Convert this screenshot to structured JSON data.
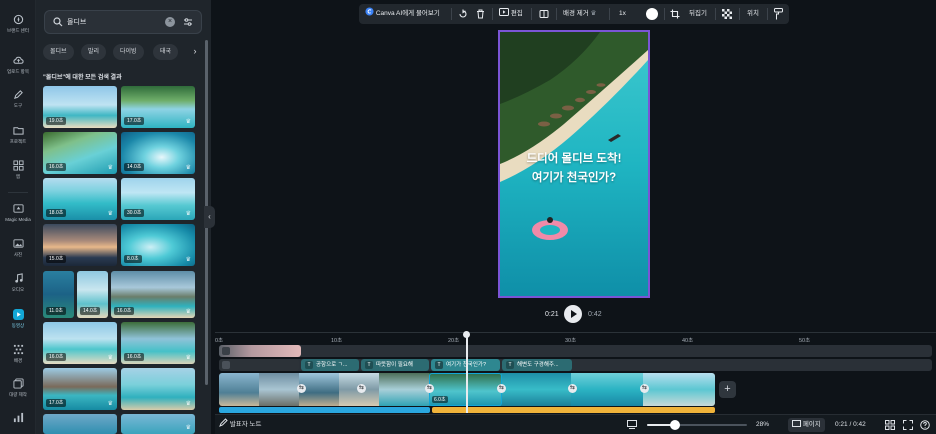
{
  "rail": [
    {
      "label": "브랜드 센터",
      "icon": "brand-center-icon"
    },
    {
      "label": "업로드 항목",
      "icon": "upload-cloud-icon"
    },
    {
      "label": "도구",
      "icon": "pen-tool-icon"
    },
    {
      "label": "프로젝트",
      "icon": "folder-icon"
    },
    {
      "label": "앱",
      "icon": "apps-grid-icon"
    },
    {
      "label": "Magic Media",
      "icon": "magic-media-icon"
    },
    {
      "label": "사진",
      "icon": "image-icon"
    },
    {
      "label": "오디오",
      "icon": "music-note-icon"
    },
    {
      "label": "동영상",
      "icon": "video-icon"
    },
    {
      "label": "배경",
      "icon": "pattern-icon"
    },
    {
      "label": "대량 제작",
      "icon": "bulk-create-icon"
    },
    {
      "label": "",
      "icon": "charts-icon"
    }
  ],
  "search": {
    "value": "몰디브",
    "placeholder": ""
  },
  "chips": [
    "몰디브",
    "발리",
    "다이빙",
    "태국"
  ],
  "results_title": "\"몰디브\"에 대한 모든 검색 결과",
  "thumbnails": [
    {
      "duration": "19.0초",
      "premium": false
    },
    {
      "duration": "17.0초",
      "premium": true
    },
    {
      "duration": "16.0초",
      "premium": true
    },
    {
      "duration": "14.0초",
      "premium": true
    },
    {
      "duration": "18.0초",
      "premium": true
    },
    {
      "duration": "30.0초",
      "premium": true
    },
    {
      "duration": "15.0초",
      "premium": false
    },
    {
      "duration": "8.0초",
      "premium": true
    },
    {
      "duration": "11.0초",
      "premium": false
    },
    {
      "duration": "14.0초",
      "premium": false
    },
    {
      "duration": "16.0초",
      "premium": true
    },
    {
      "duration": "16.0초",
      "premium": true
    },
    {
      "duration": "16.0초",
      "premium": true
    },
    {
      "duration": "17.0초",
      "premium": true
    },
    {
      "duration": "",
      "premium": true
    }
  ],
  "toolbar": {
    "ask_ai": "Canva AI에게 물어보기",
    "edit": "편집",
    "remove_bg": "배경 제거",
    "speed": "1x",
    "flip": "뒤집기",
    "position": "위치"
  },
  "canvas": {
    "line1": "드디어 몰디브 도착!",
    "line2": "여기가 천국인가?"
  },
  "playback": {
    "current": "0:21",
    "total": "0:42"
  },
  "timeline": {
    "ticks": [
      "0초",
      "10초",
      "20초",
      "30초",
      "40초",
      "50초"
    ],
    "text_clips": [
      "공항으로 ㄱ...",
      "따뜻함이 필요해",
      "여기가 천국인가?",
      "해변도 구경해주..."
    ],
    "selected_clip_duration": "6.0초"
  },
  "status": {
    "notes": "발표자 노트",
    "zoom": "28%",
    "zoom_fraction": 0.28,
    "pages": "페이지",
    "time": "0:21 / 0:42"
  }
}
